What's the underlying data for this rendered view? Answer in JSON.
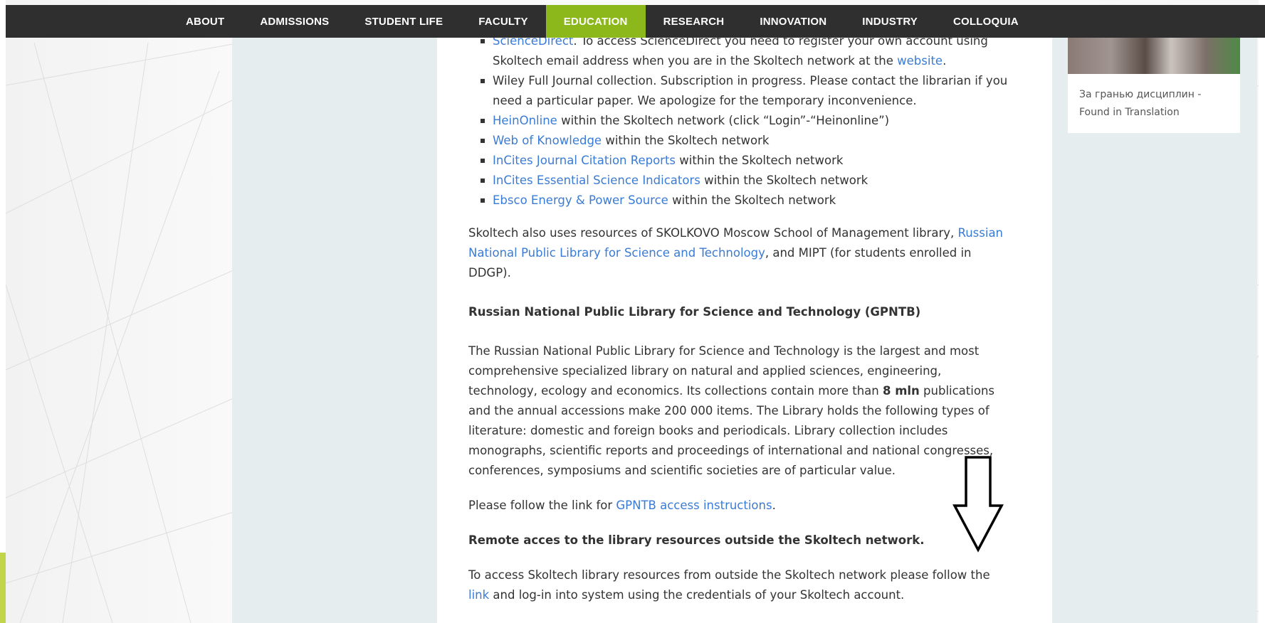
{
  "nav": {
    "items": [
      "ABOUT",
      "ADMISSIONS",
      "STUDENT LIFE",
      "FACULTY",
      "EDUCATION",
      "RESEARCH",
      "INNOVATION",
      "INDUSTRY",
      "COLLOQUIA"
    ],
    "active": "EDUCATION"
  },
  "resources": [
    {
      "link": "ScienceDirect",
      "text": ". To access ScienceDirect you need to register your own account using Skoltech email address when you are in the Skoltech network at the ",
      "link2": "website",
      "text2": "."
    },
    {
      "link": "",
      "text": "Wiley Full Journal collection. Subscription in progress. Please contact the librarian if you need a particular paper.  We apologize for the temporary inconvenience."
    },
    {
      "link": "HeinOnline",
      "text": " within the Skoltech network (click “Login”-“Heinonline”)"
    },
    {
      "link": "Web of Knowledge",
      "text": " within the Skoltech network"
    },
    {
      "link": "InCites Journal Citation Reports",
      "text": " within the Skoltech network"
    },
    {
      "link": "InCites Essential Science Indicators",
      "text": " within the Skoltech network"
    },
    {
      "link": "Ebsco Energy & Power Source",
      "text": "  within the Skoltech network"
    }
  ],
  "skolkovo": {
    "before": "Skoltech also uses resources of SKOLKOVO Moscow School of Management library, ",
    "link": "Russian National Public Library for Science and Technology",
    "after": ", and MIPT (for students enrolled in DDGP)."
  },
  "gpntb": {
    "heading": "Russian National Public Library for Science and Technology (GPNTB)",
    "body_before": "The Russian National Public Library for Science and Technology is the largest and most comprehensive specialized library on natural and applied sciences, engineering, technology, ecology and economics. Its collections contain more than ",
    "body_bold": "8 mln",
    "body_after": " publications and the annual accessions make 200 000 items. The Library holds the following types of literature: domestic and foreign books and periodicals. Library collection includes monographs, scientific reports and proceedings of international and national congresses, conferences, symposiums and scientific societies are of particular value.",
    "follow_before": "Please follow the link for ",
    "follow_link": "GPNTB access instructions",
    "follow_after": "."
  },
  "remote": {
    "heading": "Remote acces to the library resources outside the Skoltech network.",
    "before": "To access Skoltech library resources from outside the Skoltech network please follow the ",
    "link": "link",
    "after": " and log-in into system using the credentials of your Skoltech account."
  },
  "sidebar": {
    "caption": "За гранью дисциплин - Found in Translation"
  }
}
